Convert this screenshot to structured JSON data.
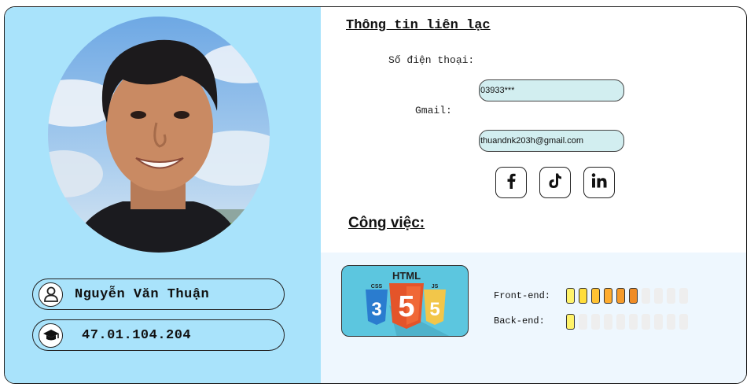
{
  "profile": {
    "name": "Nguyễn Văn Thuận",
    "student_id": "47.01.104.204"
  },
  "contact": {
    "heading": "Thông tin liên lạc",
    "phone_label": "Số điện thoại:",
    "phone_value": "03933***",
    "email_label": "Gmail:",
    "email_value": "thuandnk203h@gmail.com",
    "socials": [
      "facebook-icon",
      "tiktok-icon",
      "linkedin-icon"
    ]
  },
  "work": {
    "heading": "Công việc:",
    "badge_text": "HTML",
    "badge_js": "JS",
    "badge_css": "CSS",
    "skills": [
      {
        "label": "Front-end:",
        "level": 6,
        "total": 10
      },
      {
        "label": "Back-end:",
        "level": 1,
        "total": 10
      }
    ]
  },
  "colors": {
    "left_panel": "#a9e3fb",
    "right_bottom": "#eef7fe",
    "field_bg": "#d2eef0",
    "skill_gradient": [
      "#fff36a",
      "#ffdd3c",
      "#ffc233",
      "#ffac2e",
      "#f69b2a",
      "#ef8c26"
    ],
    "skill_empty": "#eeeeee"
  }
}
